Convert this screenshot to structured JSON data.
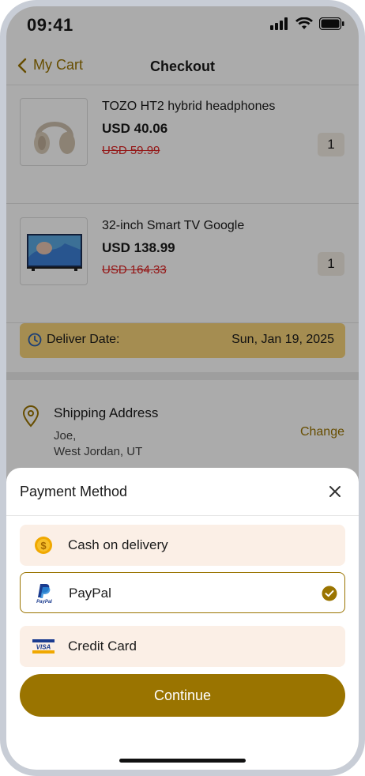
{
  "status_bar": {
    "time": "09:41"
  },
  "header": {
    "back_label": "My Cart",
    "title": "Checkout"
  },
  "products": [
    {
      "name": "TOZO HT2 hybrid headphones",
      "price": "USD 40.06",
      "old_price": "USD 59.99",
      "quantity": "1"
    },
    {
      "name": "32-inch Smart TV Google",
      "price": "USD 138.99",
      "old_price": "USD 164.33",
      "quantity": "1"
    }
  ],
  "delivery": {
    "label": "Deliver Date:",
    "date": "Sun, Jan 19, 2025"
  },
  "shipping": {
    "heading": "Shipping Address",
    "name": "Joe,",
    "location": "West Jordan, UT",
    "change_label": "Change"
  },
  "payment_sheet": {
    "title": "Payment Method",
    "options": [
      {
        "label": "Cash on delivery",
        "icon": "coin-icon",
        "selected": false
      },
      {
        "label": "PayPal",
        "icon": "paypal-icon",
        "selected": true
      },
      {
        "label": "Credit Card",
        "icon": "visa-icon",
        "selected": false
      }
    ],
    "continue_label": "Continue"
  },
  "colors": {
    "accent": "#9a7400",
    "deliver_bg": "#f6d27a",
    "option_bg": "#fbefe6"
  }
}
